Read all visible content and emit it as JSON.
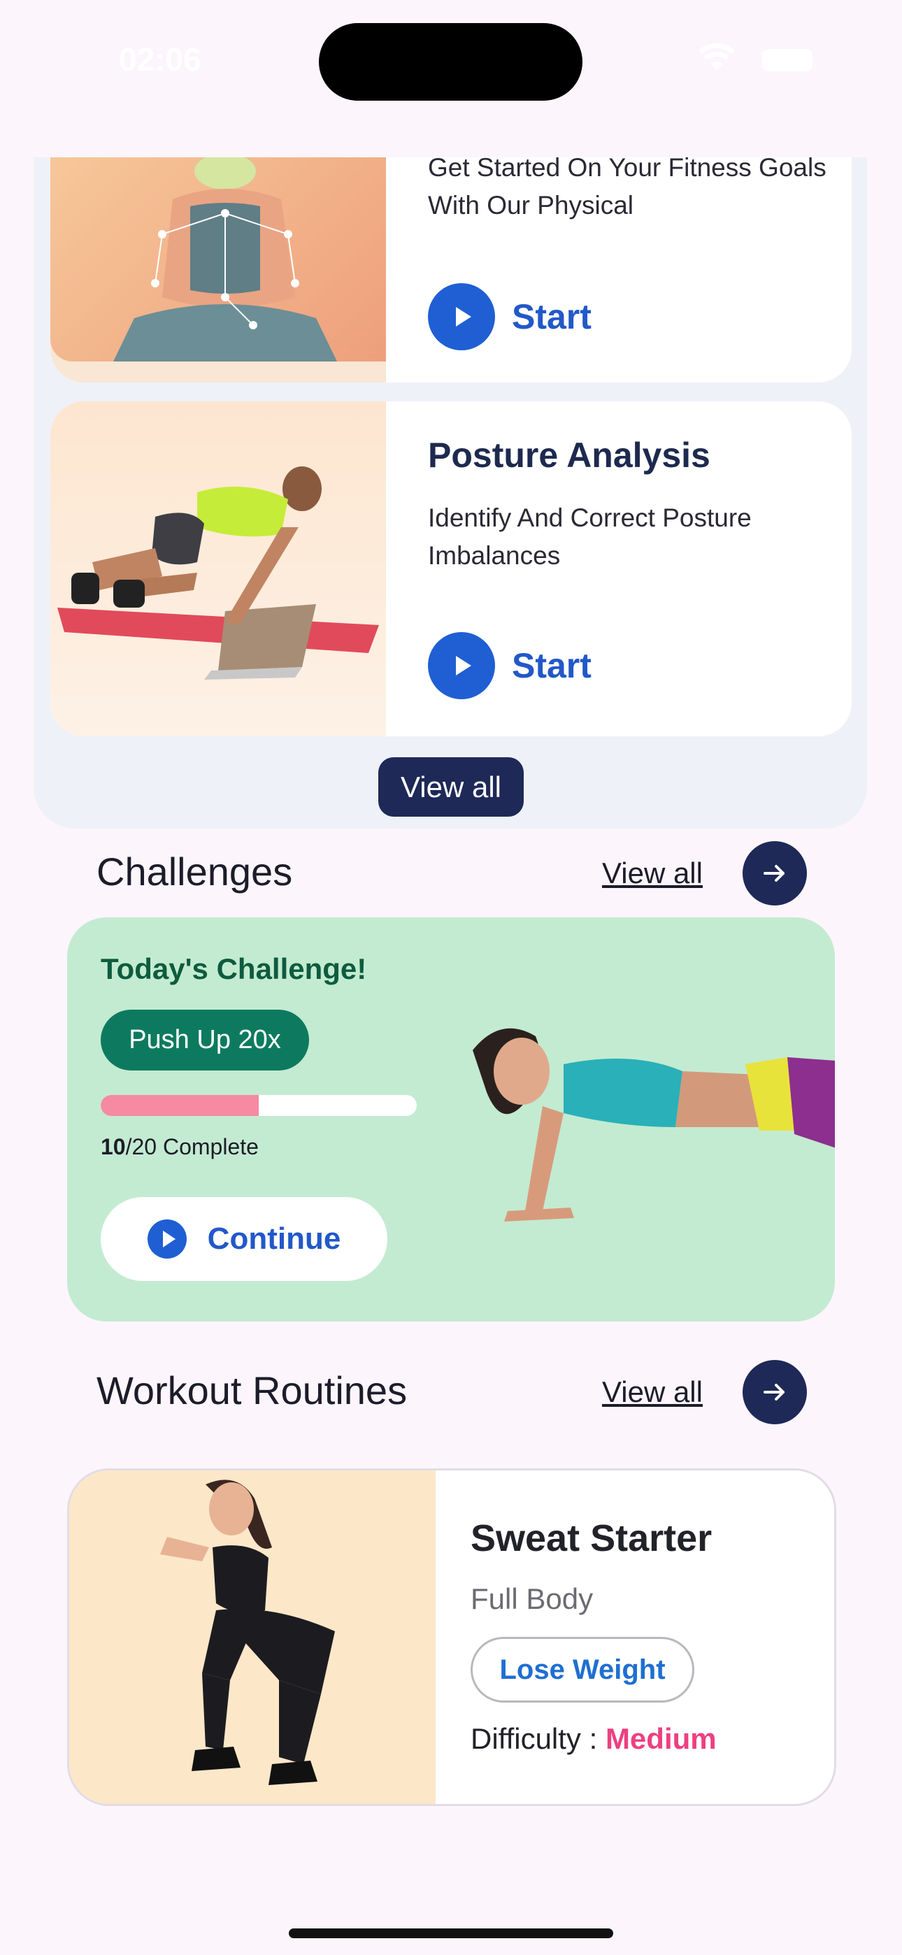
{
  "status_bar": {
    "time": "02:06"
  },
  "top_cards": [
    {
      "title": "",
      "description": "Get Started On Your Fitness Goals With Our Physical",
      "action": "Start"
    },
    {
      "title": "Posture Analysis",
      "description": "Identify And Correct Posture Imbalances",
      "action": "Start"
    }
  ],
  "top_view_all": "View all",
  "challenges": {
    "header": "Challenges",
    "view_all": "View all",
    "card": {
      "title": "Today's Challenge!",
      "task": "Push Up 20x",
      "done": "10",
      "total_suffix": "/20 Complete",
      "progress": 0.5,
      "continue": "Continue"
    }
  },
  "workouts": {
    "header": "Workout Routines",
    "view_all": "View all",
    "card": {
      "title": "Sweat Starter",
      "subtitle": "Full Body",
      "tag": "Lose Weight",
      "difficulty_label": "Difficulty : ",
      "difficulty_value": "Medium"
    }
  },
  "colors": {
    "accent_blue": "#1f5fd3",
    "navy": "#1e2957",
    "challenge_green": "#c3ebd1",
    "pill_green": "#0d7a5f",
    "progress_pink": "#f58aa2",
    "difficulty_pink": "#ee3f82"
  },
  "icons": [
    "play-icon",
    "arrow-right-icon",
    "wifi-icon",
    "battery-icon"
  ]
}
